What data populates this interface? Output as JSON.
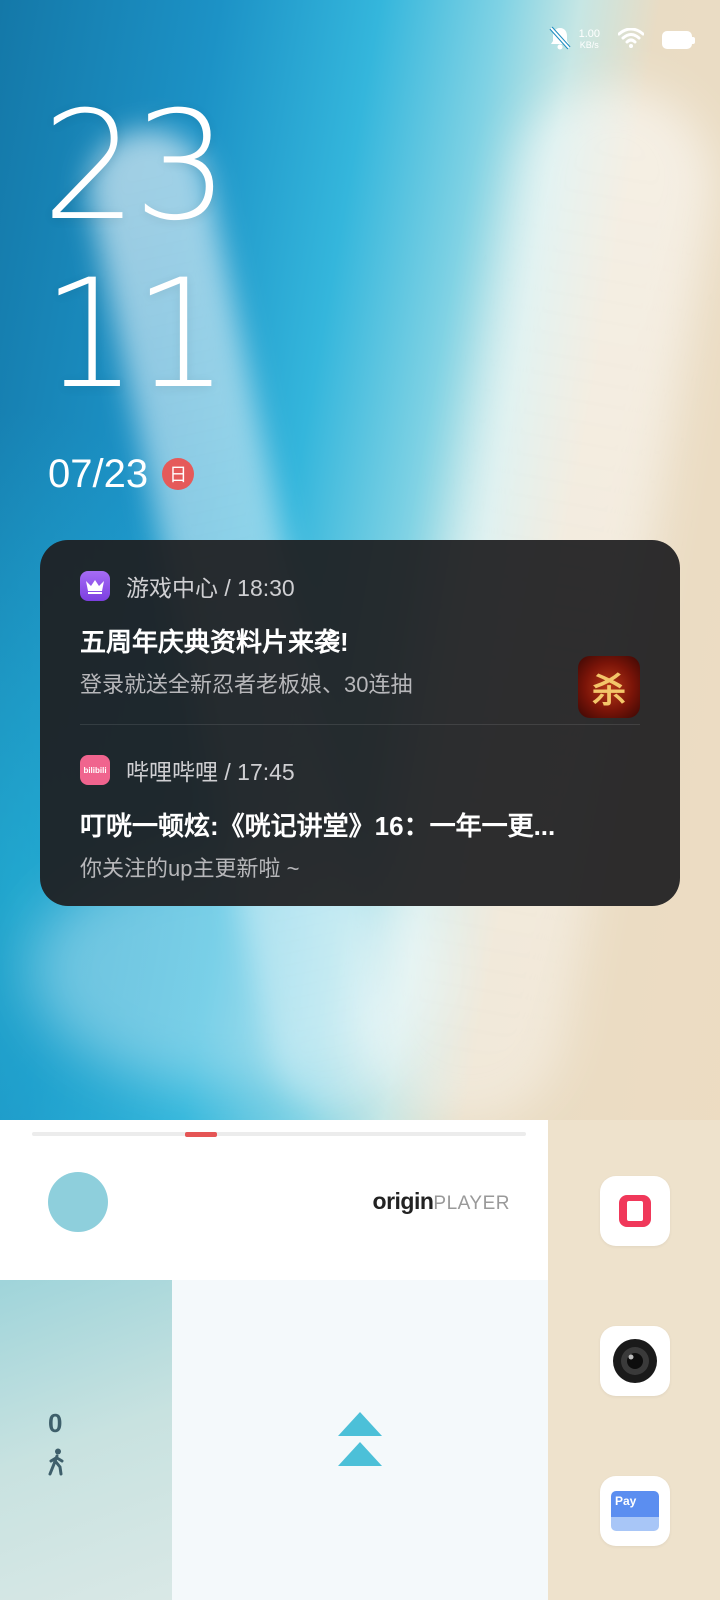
{
  "status_bar": {
    "net_speed": "1.00",
    "net_unit": "KB/s",
    "icons": [
      "bell-muted-icon",
      "wifi-icon",
      "battery-icon"
    ]
  },
  "clock": {
    "hour": "23",
    "minute": "11",
    "date": "07/23",
    "weekday": "日"
  },
  "notifications": [
    {
      "app": "游戏中心",
      "time": "18:30",
      "header": "游戏中心 / 18:30",
      "title": "五周年庆典资料片来袭!",
      "body": "登录就送全新忍者老板娘、30连抽",
      "thumbnail_text": "杀"
    },
    {
      "app": "哔哩哔哩",
      "time": "17:45",
      "header": "哔哩哔哩 / 17:45",
      "icon_text": "bilibili",
      "title": "叮咣一顿炫:《咣记讲堂》16：一年一更...",
      "body": "你关注的up主更新啦 ~"
    }
  ],
  "music_widget": {
    "brand_primary": "origin",
    "brand_secondary": "PLAYER",
    "progress": 0.33
  },
  "steps_widget": {
    "count": "0"
  },
  "dock_apps": [
    "red-square-app-icon",
    "camera-icon",
    "pay-wallet-icon"
  ],
  "dock_pay_label": "Pay",
  "colors": {
    "accent_red": "#e55555",
    "card_bg": "#1e1e20",
    "swipe_arrow": "#4cc0d8"
  }
}
